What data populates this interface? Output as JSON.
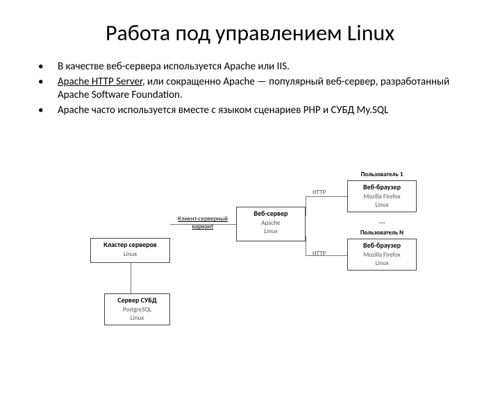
{
  "title": "Работа под управлением Linux",
  "bullets": [
    {
      "text": "В качестве веб-сервера используется Apache или IIS."
    },
    {
      "link": "Apache HTTP Server",
      "text_after": ", или сокращенно Apache — популярный веб-сервер, разработанный Apache Software Foundation."
    },
    {
      "text": "Apache часто используется вместе с языком сценариев PHP и СУБД My.SQL"
    }
  ],
  "diagram": {
    "user1": {
      "title": "Пользователь 1",
      "sub1": "Веб-браузер",
      "sub2": "Mozilla Firefox",
      "sub3": "Linux"
    },
    "userN": {
      "title": "Пользователь N",
      "sub1": "Веб-браузер",
      "sub2": "Mozilla Firefox",
      "sub3": "Linux"
    },
    "dots": "...",
    "webserver": {
      "title": "Веб-сервер",
      "sub2": "Apache",
      "sub3": "Linux"
    },
    "cluster": {
      "title": "Кластер серверов",
      "sub3": "Linux"
    },
    "dbserver": {
      "title": "Сервер СУБД",
      "sub2": "PostgreSQL",
      "sub3": "Linux"
    },
    "label_http1": "HTTP",
    "label_http2": "HTTP",
    "label_cs": "Клиент-серверный вариант"
  }
}
